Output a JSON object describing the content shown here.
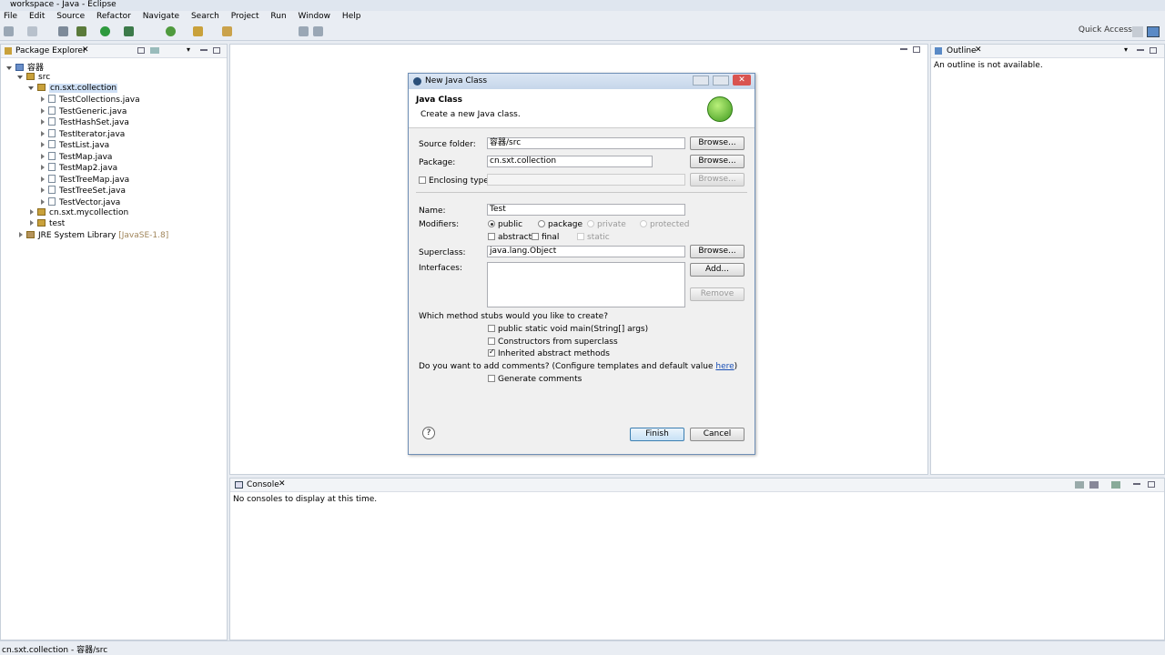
{
  "window": {
    "title": "workspace - Java - Eclipse"
  },
  "menu": [
    "File",
    "Edit",
    "Source",
    "Refactor",
    "Navigate",
    "Search",
    "Project",
    "Run",
    "Window",
    "Help"
  ],
  "quick_access": "Quick Access",
  "package_explorer": {
    "tab": "Package Explorer",
    "project": "容器",
    "src": "src",
    "package_open": "cn.sxt.collection",
    "files": [
      "TestCollections.java",
      "TestGeneric.java",
      "TestHashSet.java",
      "TestIterator.java",
      "TestList.java",
      "TestMap.java",
      "TestMap2.java",
      "TestTreeMap.java",
      "TestTreeSet.java",
      "TestVector.java"
    ],
    "package2": "cn.sxt.mycollection",
    "package3": "test",
    "jre": "JRE System Library",
    "jre_version": "[JavaSE-1.8]"
  },
  "outline": {
    "tab": "Outline",
    "message": "An outline is not available."
  },
  "console": {
    "tab": "Console",
    "message": "No consoles to display at this time."
  },
  "dialog": {
    "title": "New Java Class",
    "heading": "Java Class",
    "subheading": "Create a new Java class.",
    "source_folder_label": "Source folder:",
    "source_folder_value": "容器/src",
    "package_label": "Package:",
    "package_value": "cn.sxt.collection",
    "enclosing_label": "Enclosing type:",
    "browse": "Browse...",
    "name_label": "Name:",
    "name_value": "Test",
    "modifiers_label": "Modifiers:",
    "mod_public": "public",
    "mod_package": "package",
    "mod_private": "private",
    "mod_protected": "protected",
    "mod_abstract": "abstract",
    "mod_final": "final",
    "mod_static": "static",
    "superclass_label": "Superclass:",
    "superclass_value": "java.lang.Object",
    "interfaces_label": "Interfaces:",
    "add": "Add...",
    "remove": "Remove",
    "stubs_question": "Which method stubs would you like to create?",
    "stub_main": "public static void main(String[] args)",
    "stub_ctor": "Constructors from superclass",
    "stub_inherited": "Inherited abstract methods",
    "comments_question": "Do you want to add comments? (Configure templates and default value ",
    "comments_link": "here",
    "comments_close": ")",
    "generate_comments": "Generate comments",
    "finish": "Finish",
    "cancel": "Cancel"
  },
  "status": {
    "text": "cn.sxt.collection - 容器/src"
  }
}
